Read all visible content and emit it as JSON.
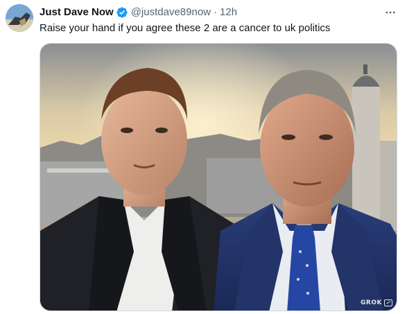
{
  "tweet": {
    "display_name": "Just Dave Now",
    "handle": "@justdave89now",
    "separator": "·",
    "time": "12h",
    "text": "Raise your hand if you agree these 2 are a cancer to uk politics",
    "verified": true,
    "more_icon": "more-horizontal-icon",
    "media": {
      "description": "AI-generated photo of two men in suits on a rooftop at sunset",
      "watermark": "GROK"
    }
  },
  "colors": {
    "name": "#0f1419",
    "secondary": "#536471",
    "verified_blue": "#1d9bf0",
    "border": "#cfd9de"
  }
}
